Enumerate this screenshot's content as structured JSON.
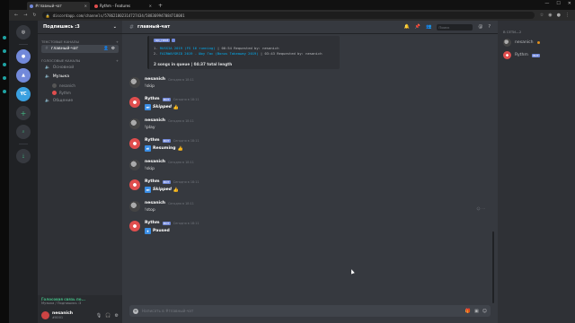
{
  "browser": {
    "tabs": [
      {
        "title": "#главный-чат",
        "active": true
      },
      {
        "title": "Rythm - Features",
        "active": false
      }
    ],
    "url": "discordapp.com/channels/578621802314727434/588369947084718081"
  },
  "server": {
    "name": "Подпишись :3",
    "categories": {
      "text": "ТЕКСТОВЫЕ КАНАЛЫ",
      "voice": "ГОЛОСОВЫЕ КАНАЛЫ"
    },
    "text_channels": [
      "главный-чат"
    ],
    "voice_channels": [
      "Основной",
      "Музыка",
      "Общение"
    ],
    "voice_users": [
      "nesanich",
      "Rythm"
    ]
  },
  "voice_status": {
    "connected": "Голосовая связь по...",
    "sub": "Музыка / Подпишись :3"
  },
  "user_panel": {
    "name": "nesanich",
    "status": "#0001"
  },
  "chat": {
    "channel": "главный-чат",
    "search_placeholder": "Поиск",
    "composer_placeholder": "Написать в #главный-чат",
    "embed": {
      "pills": [
        "up_next",
        ""
      ],
      "queue": [
        {
          "n": "1.",
          "title": "RUSSIA 2019 (FS 16 running)",
          "meta": "| 00:54 Requested by: nesanich"
        },
        {
          "n": "2.",
          "title": "FAIRWAYGRID 2019 - Шоу Гас (Bonus Takeaway 2019)",
          "meta": "| 03:43 Requested by: nesanich"
        }
      ],
      "summary": "2 songs in queue | 04:37 total length"
    },
    "messages": [
      {
        "author": "nesanich",
        "bot": false,
        "time": "Сегодня в 18:11",
        "text": "!skip",
        "style": "plain"
      },
      {
        "author": "Rythm",
        "bot": true,
        "time": "Сегодня в 18:11",
        "text": "Skipped",
        "style": "italic",
        "icon": "⏭"
      },
      {
        "author": "nesanich",
        "bot": false,
        "time": "Сегодня в 18:11",
        "text": "!play",
        "style": "plain"
      },
      {
        "author": "Rythm",
        "bot": true,
        "time": "Сегодня в 18:11",
        "text": "Resuming",
        "style": "boldn",
        "icon": "⏯"
      },
      {
        "author": "nesanich",
        "bot": false,
        "time": "Сегодня в 18:11",
        "text": "!skip",
        "style": "plain"
      },
      {
        "author": "Rythm",
        "bot": true,
        "time": "Сегодня в 18:11",
        "text": "Skipped",
        "style": "italic",
        "icon": "⏭"
      },
      {
        "author": "nesanich",
        "bot": false,
        "time": "Сегодня в 18:11",
        "text": "!stop",
        "style": "plain"
      },
      {
        "author": "Rythm",
        "bot": true,
        "time": "Сегодня в 18:11",
        "text": "Paused",
        "style": "boldn",
        "icon": "⏸"
      }
    ],
    "bot_badge": "BOT"
  },
  "members": {
    "header": "В СЕТИ—2",
    "list": [
      {
        "name": "nesanich",
        "bot": false
      },
      {
        "name": "Rythm",
        "bot": true
      }
    ]
  },
  "colors": {
    "accent": "#7289da",
    "link": "#00b0f4",
    "online": "#43b581"
  }
}
